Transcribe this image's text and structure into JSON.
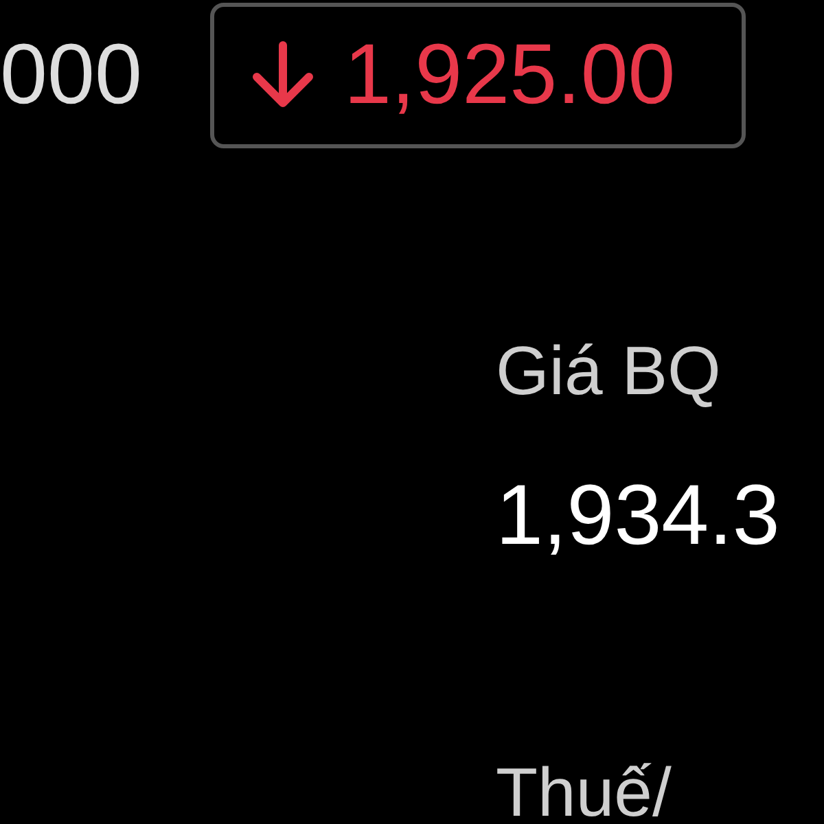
{
  "quote": {
    "volume": "000",
    "change": {
      "kind": "decrease",
      "value": "1,925.00"
    }
  },
  "avg_price": {
    "label": "Giá BQ",
    "value": "1,934.3"
  },
  "tax": {
    "label": "Thuế/"
  }
}
